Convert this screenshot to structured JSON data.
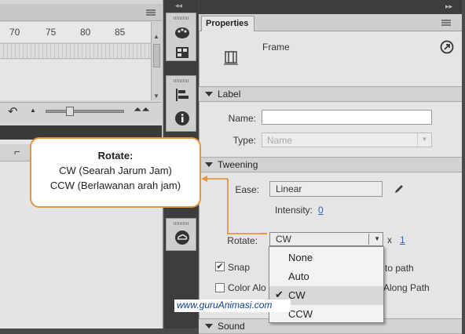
{
  "timeline": {
    "ruler_numbers": [
      "70",
      "75",
      "80",
      "85"
    ]
  },
  "properties": {
    "tab_label": "Properties",
    "object_type": "Frame",
    "sections": {
      "label": "Label",
      "tweening": "Tweening",
      "sound": "Sound"
    },
    "label_section": {
      "name_label": "Name:",
      "name_value": "",
      "type_label": "Type:",
      "type_value": "Name"
    },
    "tweening_section": {
      "ease_label": "Ease:",
      "ease_value": "Linear",
      "intensity_label": "Intensity:",
      "intensity_value": "0",
      "rotate_label": "Rotate:",
      "rotate_value": "CW",
      "rotate_times_label": "x",
      "rotate_times_value": "1",
      "snap_label": "Snap",
      "snap_checked": true,
      "color_along_label": "Color Alo",
      "orient_to_path_label": "to path",
      "scale_along_label": "Along Path"
    }
  },
  "rotate_menu": {
    "options": [
      "None",
      "Auto",
      "CW",
      "CCW"
    ],
    "selected": "CW"
  },
  "callout": {
    "title": "Rotate:",
    "line1": "CW (Searah Jarum Jam)",
    "line2": "CCW (Berlawanan arah jam)"
  },
  "watermark": "www.guruAnimasi.com",
  "colors": {
    "callout_border": "#e8953a",
    "link_blue": "#2a62c9",
    "watermark_blue": "#0b3d8c"
  }
}
